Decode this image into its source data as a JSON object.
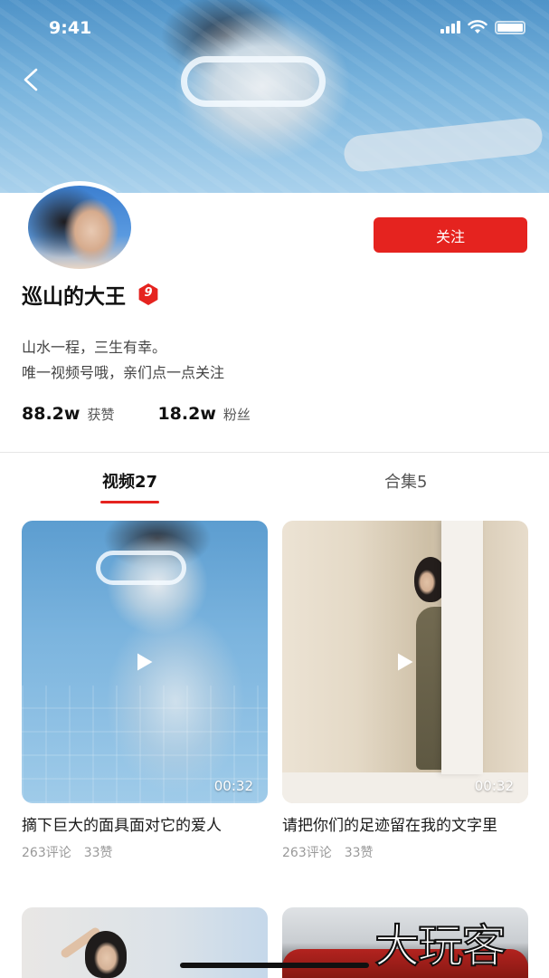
{
  "status_bar": {
    "time": "9:41"
  },
  "profile": {
    "name": "巡山的大王",
    "level": "9",
    "follow_label": "关注",
    "bio": [
      "山水一程，三生有幸。",
      "唯一视频号哦，亲们点一点关注"
    ],
    "stats": [
      {
        "value": "88.2w",
        "label": "获赞"
      },
      {
        "value": "18.2w",
        "label": "粉丝"
      }
    ]
  },
  "tabs": [
    {
      "label": "视频27",
      "active": true
    },
    {
      "label": "合集5",
      "active": false
    }
  ],
  "videos": [
    {
      "title": "摘下巨大的面具面对它的爱人",
      "duration": "00:32",
      "comments": "263评论",
      "likes": "33赞"
    },
    {
      "title": "请把你们的足迹留在我的文字里",
      "duration": "00:32",
      "comments": "263评论",
      "likes": "33赞"
    }
  ],
  "watermark": "大玩客",
  "colors": {
    "accent": "#e5231f"
  },
  "icons": [
    "back-arrow-icon",
    "signal-icon",
    "wifi-icon",
    "battery-icon",
    "level-badge-icon",
    "play-icon"
  ]
}
